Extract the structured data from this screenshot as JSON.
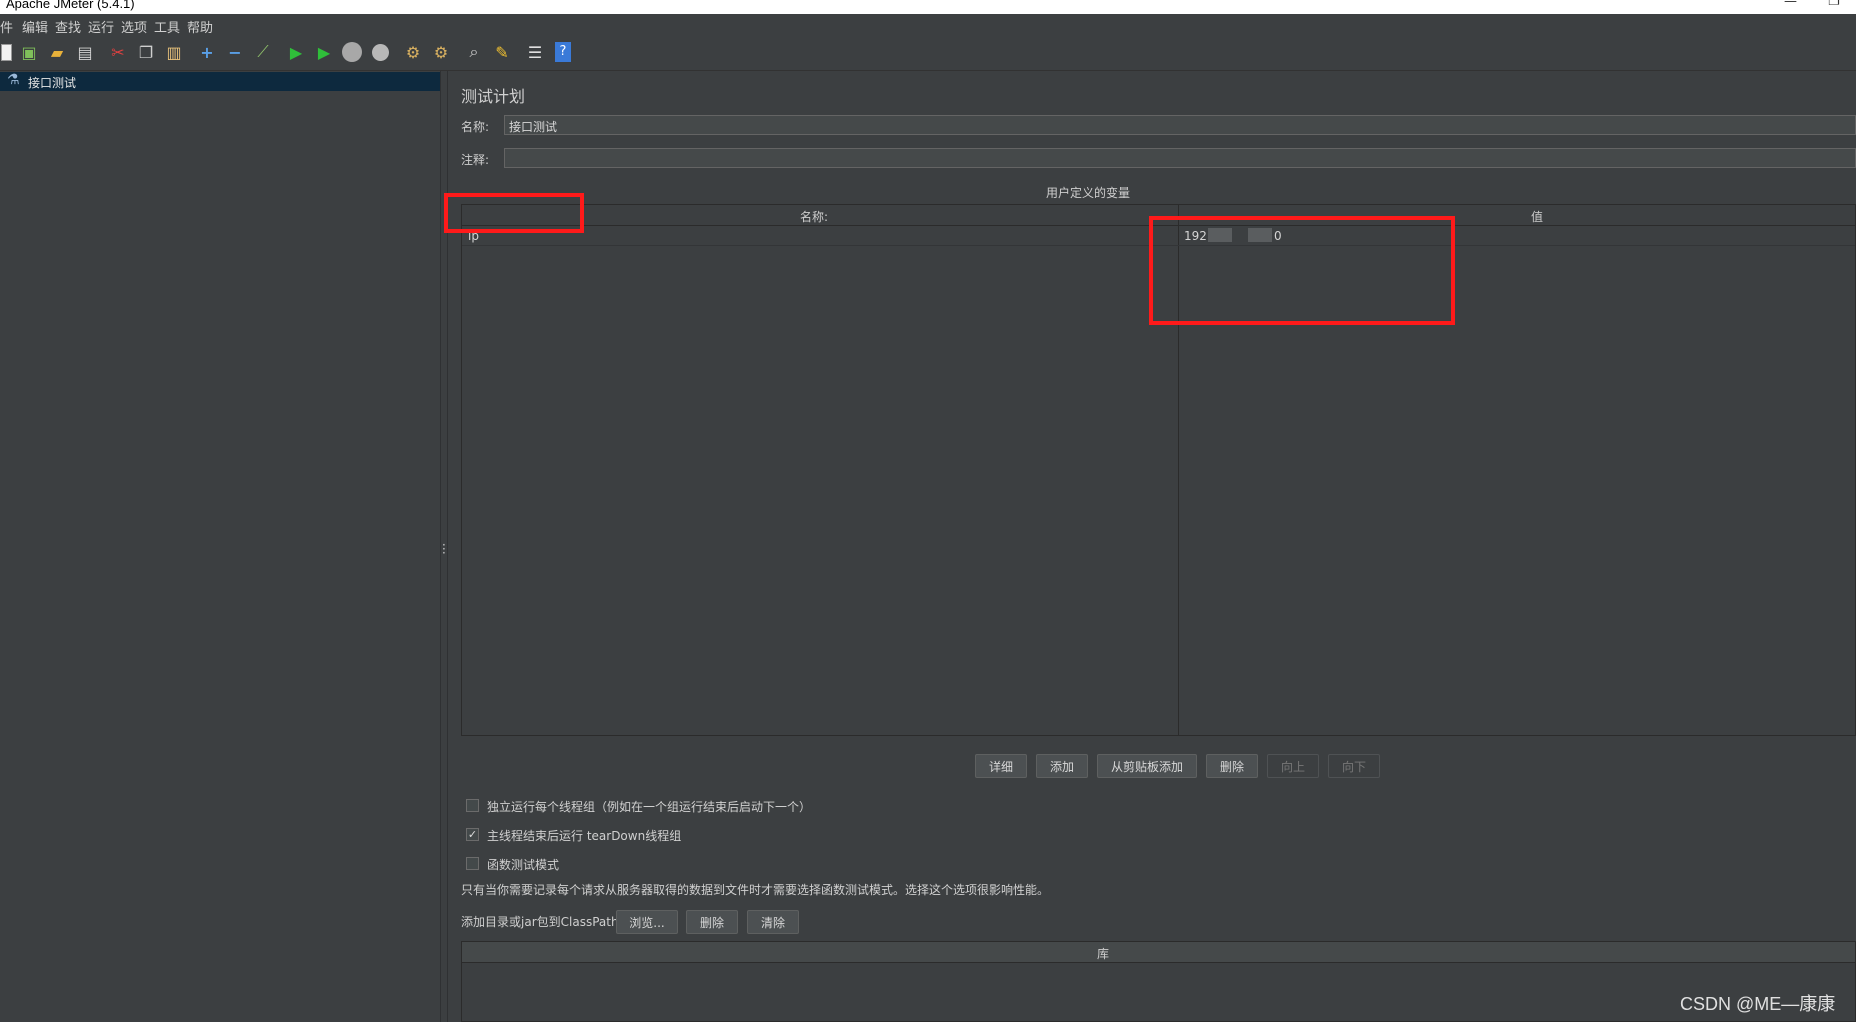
{
  "window": {
    "title": "Apache JMeter (5.4.1)"
  },
  "menu": [
    "件",
    "编辑",
    "查找",
    "运行",
    "选项",
    "工具",
    "帮助"
  ],
  "toolbar": {
    "icons": [
      "new-icon",
      "templates-icon",
      "open-icon",
      "save-icon",
      "cut-icon",
      "copy-icon",
      "paste-icon",
      "expand-icon",
      "collapse-icon",
      "toggle-icon",
      "start-icon",
      "start-no-pauses-icon",
      "stop-icon",
      "shutdown-icon",
      "clear-icon",
      "clear-all-icon",
      "search-icon",
      "reset-search-icon",
      "function-helper-icon",
      "help-icon"
    ]
  },
  "tree": {
    "root_label": "接口测试"
  },
  "test_plan": {
    "title": "测试计划",
    "name_label": "名称:",
    "name_value": "接口测试",
    "comment_label": "注释:",
    "comment_value": ""
  },
  "variables": {
    "title": "用户定义的变量",
    "col_name": "名称:",
    "col_value": "值",
    "rows": [
      {
        "name": "ip",
        "value_prefix": "192.",
        "value_suffix": "0"
      }
    ]
  },
  "buttons": {
    "detail": "详细",
    "add": "添加",
    "add_from_clipboard": "从剪贴板添加",
    "delete": "删除",
    "up": "向上",
    "down": "向下"
  },
  "options": {
    "serialize": {
      "label": "独立运行每个线程组（例如在一个组运行结束后启动下一个）",
      "checked": false
    },
    "teardown": {
      "label": "主线程结束后运行 tearDown线程组",
      "checked": true
    },
    "functional": {
      "label": "函数测试模式",
      "checked": false
    },
    "note": "只有当你需要记录每个请求从服务器取得的数据到文件时才需要选择函数测试模式。选择这个选项很影响性能。"
  },
  "classpath": {
    "label": "添加目录或jar包到ClassPath",
    "browse": "浏览...",
    "delete": "删除",
    "clear": "清除",
    "table_header": "库"
  },
  "watermark": "CSDN @ME—康康",
  "colors": {
    "highlight": "#ff1a1a",
    "background": "#3c3f41",
    "selection": "#0d293e"
  }
}
